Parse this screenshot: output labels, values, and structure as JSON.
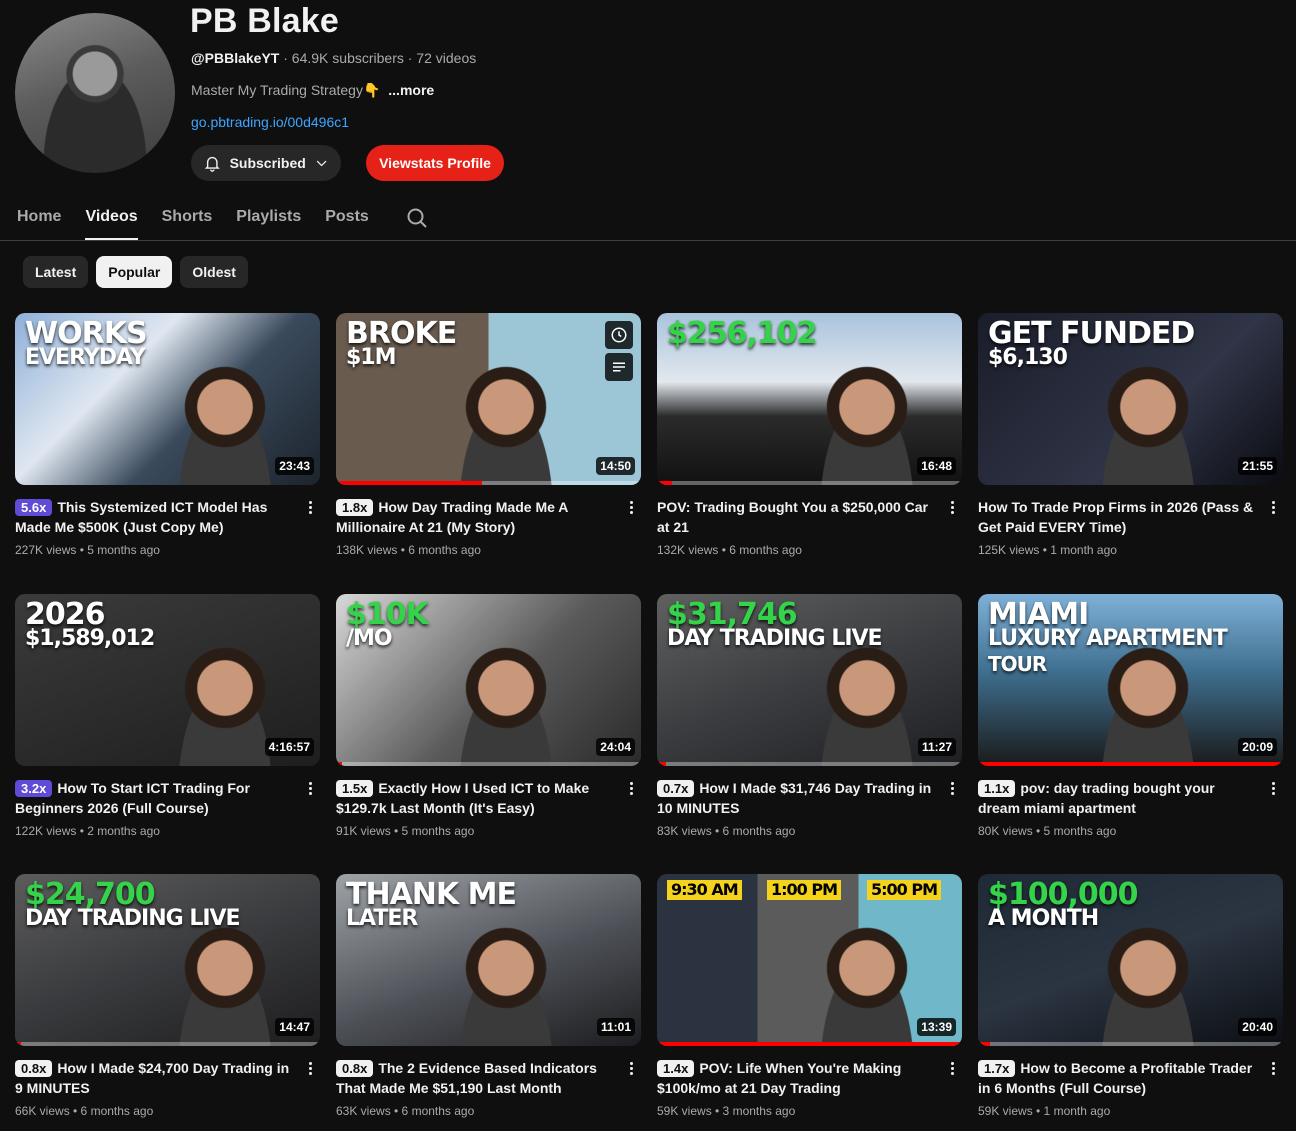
{
  "channel": {
    "name": "PB Blake",
    "handle": "@PBBlakeYT",
    "meta": " · 64.9K subscribers · 72 videos",
    "description": "Master My Trading Strategy👇",
    "more": "...more",
    "link": "go.pbtrading.io/00d496c1"
  },
  "buttons": {
    "subscribed": "Subscribed",
    "viewstats": "Viewstats Profile"
  },
  "tabs": [
    "Home",
    "Videos",
    "Shorts",
    "Playlists",
    "Posts"
  ],
  "chips": [
    "Latest",
    "Popular",
    "Oldest"
  ],
  "colors": {
    "accent_red": "#e62117",
    "link_blue": "#3ea6ff",
    "outlier_purple": "#5e4bd6",
    "outlier_blue": "#3d6fe3",
    "outlier_white": "#f1f1f1"
  },
  "videos": [
    {
      "outlier": "5.6x",
      "title": "This Systemized ICT Model Has Made Me $500K (Just Copy Me)",
      "stats": "227K views • 5 months ago",
      "duration": "23:43",
      "thumb": [
        "WORKS",
        "EVERYDAY"
      ],
      "progress": 0
    },
    {
      "outlier": "1.8x",
      "title": "How Day Trading Made Me A Millionaire At 21 (My Story)",
      "stats": "138K views • 6 months ago",
      "duration": "14:50",
      "thumb": [
        "BROKE",
        "$1M"
      ],
      "progress": 0.48
    },
    {
      "outlier": "",
      "title": "POV: Trading Bought You a $250,000 Car at 21",
      "stats": "132K views • 6 months ago",
      "duration": "16:48",
      "thumb": [
        "$256,102"
      ],
      "progress": 0.05
    },
    {
      "outlier": "",
      "title": "How To Trade Prop Firms in 2026 (Pass & Get Paid EVERY Time)",
      "stats": "125K views • 1 month ago",
      "duration": "21:55",
      "thumb": [
        "GET FUNDED",
        "$6,130"
      ],
      "progress": 0
    },
    {
      "outlier": "3.2x",
      "title": "How To Start ICT Trading For Beginners 2026 (Full Course)",
      "stats": "122K views • 2 months ago",
      "duration": "4:16:57",
      "thumb": [
        "2026",
        "$1,589,012"
      ],
      "progress": 0
    },
    {
      "outlier": "1.5x",
      "title": "Exactly How I Used ICT to Make $129.7k Last Month (It's Easy)",
      "stats": "91K views • 5 months ago",
      "duration": "24:04",
      "thumb": [
        "$10K",
        "/MO"
      ],
      "progress": 0.02
    },
    {
      "outlier": "0.7x",
      "title": "How I Made $31,746 Day Trading in 10 MINUTES",
      "stats": "83K views • 6 months ago",
      "duration": "11:27",
      "thumb": [
        "$31,746",
        "DAY TRADING LIVE"
      ],
      "progress": 0.03
    },
    {
      "outlier": "1.1x",
      "title": "pov: day trading bought your dream miami apartment",
      "stats": "80K views • 5 months ago",
      "duration": "20:09",
      "thumb": [
        "MIAMI",
        "LUXURY APARTMENT",
        "TOUR"
      ],
      "progress": 1.0
    },
    {
      "outlier": "0.8x",
      "title": "How I Made $24,700 Day Trading in 9 MINUTES",
      "stats": "66K views • 6 months ago",
      "duration": "14:47",
      "thumb": [
        "$24,700",
        "DAY TRADING LIVE"
      ],
      "progress": 0.02
    },
    {
      "outlier": "0.8x",
      "title": "The 2 Evidence Based Indicators That Made Me $51,190 Last Month",
      "stats": "63K views • 6 months ago",
      "duration": "11:01",
      "thumb": [
        "THANK ME",
        "LATER"
      ],
      "progress": 0
    },
    {
      "outlier": "1.4x",
      "title": "POV: Life When You're Making $100k/mo at 21 Day Trading",
      "stats": "59K views • 3 months ago",
      "duration": "13:39",
      "thumb": [
        "9:30 AM",
        "1:00 PM",
        "5:00 PM"
      ],
      "progress": 1.0
    },
    {
      "outlier": "1.7x",
      "title": "How to Become a Profitable Trader in 6 Months (Full Course)",
      "stats": "59K views • 1 month ago",
      "duration": "20:40",
      "thumb": [
        "$100,000",
        "A MONTH"
      ],
      "progress": 0.04
    }
  ]
}
